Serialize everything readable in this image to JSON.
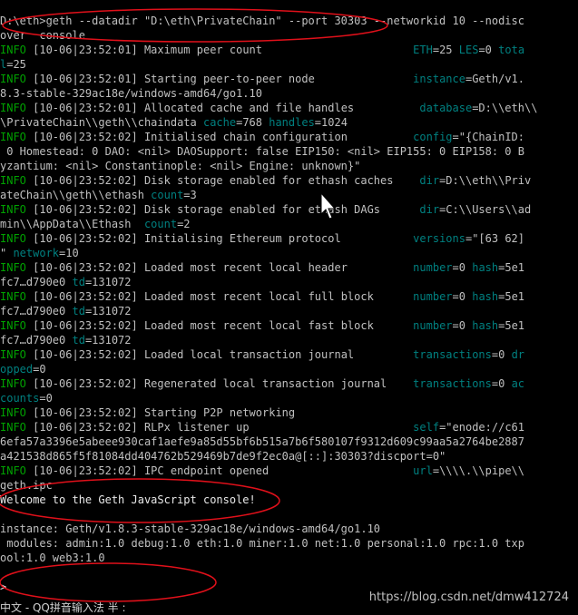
{
  "terminal": {
    "command_line_1": "D:\\eth>geth --datadir \"D:\\eth\\PrivateChain\" --port 30303 --networkid 10 --nodisc",
    "command_line_2": "over  console",
    "log": [
      [
        [
          "info",
          "INFO"
        ],
        [
          "txt",
          " [10-06|23:52:01] Maximum peer count                       "
        ],
        [
          "key",
          "ETH"
        ],
        [
          "txt",
          "=25 "
        ],
        [
          "key",
          "LES"
        ],
        [
          "txt",
          "=0 "
        ],
        [
          "key",
          "tota"
        ]
      ],
      [
        [
          "key",
          "l"
        ],
        [
          "txt",
          "=25"
        ]
      ],
      [
        [
          "info",
          "INFO"
        ],
        [
          "txt",
          " [10-06|23:52:01] Starting peer-to-peer node               "
        ],
        [
          "key",
          "instance"
        ],
        [
          "txt",
          "=Geth/v1."
        ]
      ],
      [
        [
          "txt",
          "8.3-stable-329ac18e/windows-amd64/go1.10"
        ]
      ],
      [
        [
          "info",
          "INFO"
        ],
        [
          "txt",
          " [10-06|23:52:01] Allocated cache and file handles          "
        ],
        [
          "key",
          "database"
        ],
        [
          "txt",
          "=D:\\\\eth\\\\"
        ]
      ],
      [
        [
          "txt",
          "\\PrivateChain\\\\geth\\\\chaindata "
        ],
        [
          "key",
          "cache"
        ],
        [
          "txt",
          "=768 "
        ],
        [
          "key",
          "handles"
        ],
        [
          "txt",
          "=1024"
        ]
      ],
      [
        [
          "info",
          "INFO"
        ],
        [
          "txt",
          " [10-06|23:52:02] Initialised chain configuration          "
        ],
        [
          "key",
          "config"
        ],
        [
          "txt",
          "=\"{ChainID:"
        ]
      ],
      [
        [
          "txt",
          " 0 Homestead: 0 DAO: <nil> DAOSupport: false EIP150: <nil> EIP155: 0 EIP158: 0 B"
        ]
      ],
      [
        [
          "txt",
          "yzantium: <nil> Constantinople: <nil> Engine: unknown}\""
        ]
      ],
      [
        [
          "info",
          "INFO"
        ],
        [
          "txt",
          " [10-06|23:52:02] Disk storage enabled for ethash caches    "
        ],
        [
          "key",
          "dir"
        ],
        [
          "txt",
          "=D:\\\\eth\\\\Priv"
        ]
      ],
      [
        [
          "txt",
          "ateChain\\\\geth\\\\ethash "
        ],
        [
          "key",
          "count"
        ],
        [
          "txt",
          "=3"
        ]
      ],
      [
        [
          "info",
          "INFO"
        ],
        [
          "txt",
          " [10-06|23:52:02] Disk storage enabled for ethash DAGs      "
        ],
        [
          "key",
          "dir"
        ],
        [
          "txt",
          "=C:\\\\Users\\\\ad"
        ]
      ],
      [
        [
          "txt",
          "min\\\\AppData\\\\Ethash  "
        ],
        [
          "key",
          "count"
        ],
        [
          "txt",
          "=2"
        ]
      ],
      [
        [
          "info",
          "INFO"
        ],
        [
          "txt",
          " [10-06|23:52:02] Initialising Ethereum protocol           "
        ],
        [
          "key",
          "versions"
        ],
        [
          "txt",
          "=\"[63 62]"
        ]
      ],
      [
        [
          "txt",
          "\" "
        ],
        [
          "key",
          "network"
        ],
        [
          "txt",
          "=10"
        ]
      ],
      [
        [
          "info",
          "INFO"
        ],
        [
          "txt",
          " [10-06|23:52:02] Loaded most recent local header          "
        ],
        [
          "key",
          "number"
        ],
        [
          "txt",
          "=0 "
        ],
        [
          "key",
          "hash"
        ],
        [
          "txt",
          "=5e1"
        ]
      ],
      [
        [
          "txt",
          "fc7…d790e0 "
        ],
        [
          "key",
          "td"
        ],
        [
          "txt",
          "=131072"
        ]
      ],
      [
        [
          "info",
          "INFO"
        ],
        [
          "txt",
          " [10-06|23:52:02] Loaded most recent local full block      "
        ],
        [
          "key",
          "number"
        ],
        [
          "txt",
          "=0 "
        ],
        [
          "key",
          "hash"
        ],
        [
          "txt",
          "=5e1"
        ]
      ],
      [
        [
          "txt",
          "fc7…d790e0 "
        ],
        [
          "key",
          "td"
        ],
        [
          "txt",
          "=131072"
        ]
      ],
      [
        [
          "info",
          "INFO"
        ],
        [
          "txt",
          " [10-06|23:52:02] Loaded most recent local fast block      "
        ],
        [
          "key",
          "number"
        ],
        [
          "txt",
          "=0 "
        ],
        [
          "key",
          "hash"
        ],
        [
          "txt",
          "=5e1"
        ]
      ],
      [
        [
          "txt",
          "fc7…d790e0 "
        ],
        [
          "key",
          "td"
        ],
        [
          "txt",
          "=131072"
        ]
      ],
      [
        [
          "info",
          "INFO"
        ],
        [
          "txt",
          " [10-06|23:52:02] Loaded local transaction journal         "
        ],
        [
          "key",
          "transactions"
        ],
        [
          "txt",
          "=0 "
        ],
        [
          "key",
          "dr"
        ]
      ],
      [
        [
          "key",
          "opped"
        ],
        [
          "txt",
          "=0"
        ]
      ],
      [
        [
          "info",
          "INFO"
        ],
        [
          "txt",
          " [10-06|23:52:02] Regenerated local transaction journal    "
        ],
        [
          "key",
          "transactions"
        ],
        [
          "txt",
          "=0 "
        ],
        [
          "key",
          "ac"
        ]
      ],
      [
        [
          "key",
          "counts"
        ],
        [
          "txt",
          "=0"
        ]
      ],
      [
        [
          "info",
          "INFO"
        ],
        [
          "txt",
          " [10-06|23:52:02] Starting P2P networking"
        ]
      ],
      [
        [
          "info",
          "INFO"
        ],
        [
          "txt",
          " [10-06|23:52:02] RLPx listener up                         "
        ],
        [
          "key",
          "self"
        ],
        [
          "txt",
          "=\"enode://c61"
        ]
      ],
      [
        [
          "txt",
          "6efa57a3396e5abeee930caf1aefe9a85d55bf6b515a7b6f580107f9312d609c99aa5a2764be2887"
        ]
      ],
      [
        [
          "txt",
          "a421538d865f5f81084dd404762b529469b7de9f2ec0a@[::]:30303?discport=0\""
        ]
      ],
      [
        [
          "info",
          "INFO"
        ],
        [
          "txt",
          " [10-06|23:52:02] IPC endpoint opened                      "
        ],
        [
          "key",
          "url"
        ],
        [
          "txt",
          "=\\\\\\\\.\\\\pipe\\\\"
        ]
      ],
      [
        [
          "txt",
          "geth.ipc"
        ]
      ],
      [
        [
          "white",
          "Welcome to the Geth JavaScript console!"
        ]
      ],
      [
        [
          "txt",
          ""
        ]
      ],
      [
        [
          "txt",
          "instance: Geth/v1.8.3-stable-329ac18e/windows-amd64/go1.10"
        ]
      ],
      [
        [
          "txt",
          " modules: admin:1.0 debug:1.0 eth:1.0 miner:1.0 net:1.0 personal:1.0 rpc:1.0 txp"
        ]
      ],
      [
        [
          "txt",
          "ool:1.0 web3:1.0"
        ]
      ],
      [
        [
          "txt",
          ""
        ]
      ],
      [
        [
          "white",
          "> "
        ]
      ]
    ],
    "colors": {
      "info": "#00a000",
      "key": "#008080",
      "text": "#c0c0c0",
      "annotation_ellipse": "#e0101a"
    }
  },
  "status_bar": {
    "ime": "中文 - QQ拼音输入法 半 :"
  },
  "watermark": {
    "text": "https://blog.csdn.net/dmw412724"
  }
}
